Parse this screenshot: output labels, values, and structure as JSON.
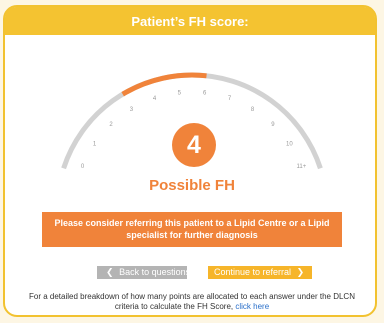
{
  "header": {
    "title": "Patient’s FH score:"
  },
  "gauge": {
    "min": 0,
    "max": 11,
    "labels": [
      "0",
      "1",
      "2",
      "3",
      "4",
      "5",
      "6",
      "7",
      "8",
      "9",
      "10",
      "11+"
    ],
    "highlight_from": 3,
    "highlight_to": 6,
    "track_color": "#d2d2d2",
    "highlight_color": "#f0833a"
  },
  "score": {
    "value": "4",
    "label": "Possible FH",
    "color": "#f0833a"
  },
  "advice": {
    "text": "Please consider referring this patient to a Lipid Centre or a Lipid specialist for further diagnosis"
  },
  "buttons": {
    "back_label": "Back to questions",
    "continue_label": "Continue to referral",
    "back_icon": "chevron-left-icon",
    "continue_icon": "chevron-right-icon"
  },
  "footnote": {
    "text": "For a detailed breakdown of how many points are allocated to each answer under the DLCN criteria to calculate the FH Score,",
    "link": "click here"
  }
}
